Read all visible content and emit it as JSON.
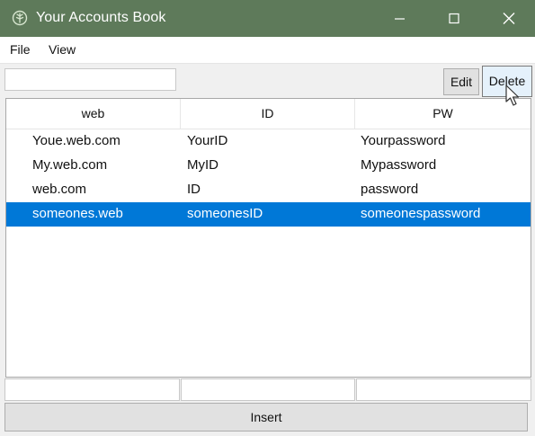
{
  "window": {
    "title": "Your Accounts Book",
    "icon": "app-leaf-icon",
    "controls": [
      "minimize-icon",
      "maximize-icon",
      "close-icon"
    ],
    "titlebar_color": "#5e7a5a"
  },
  "menu": {
    "file_label": "File",
    "view_label": "View"
  },
  "toolbar": {
    "search_value": "",
    "edit_label": "Edit",
    "delete_label": "Delete"
  },
  "table": {
    "columns": [
      "web",
      "ID",
      "PW"
    ],
    "rows": [
      {
        "web": "Youe.web.com",
        "id": "YourID",
        "pw": "Yourpassword",
        "selected": false
      },
      {
        "web": "My.web.com",
        "id": "MyID",
        "pw": "Mypassword",
        "selected": false
      },
      {
        "web": "web.com",
        "id": "ID",
        "pw": "password",
        "selected": false
      },
      {
        "web": "someones.web",
        "id": "someonesID",
        "pw": "someonespassword",
        "selected": true
      }
    ],
    "selection_color": "#0078d7"
  },
  "form": {
    "web_value": "",
    "id_value": "",
    "pw_value": "",
    "insert_label": "Insert"
  }
}
